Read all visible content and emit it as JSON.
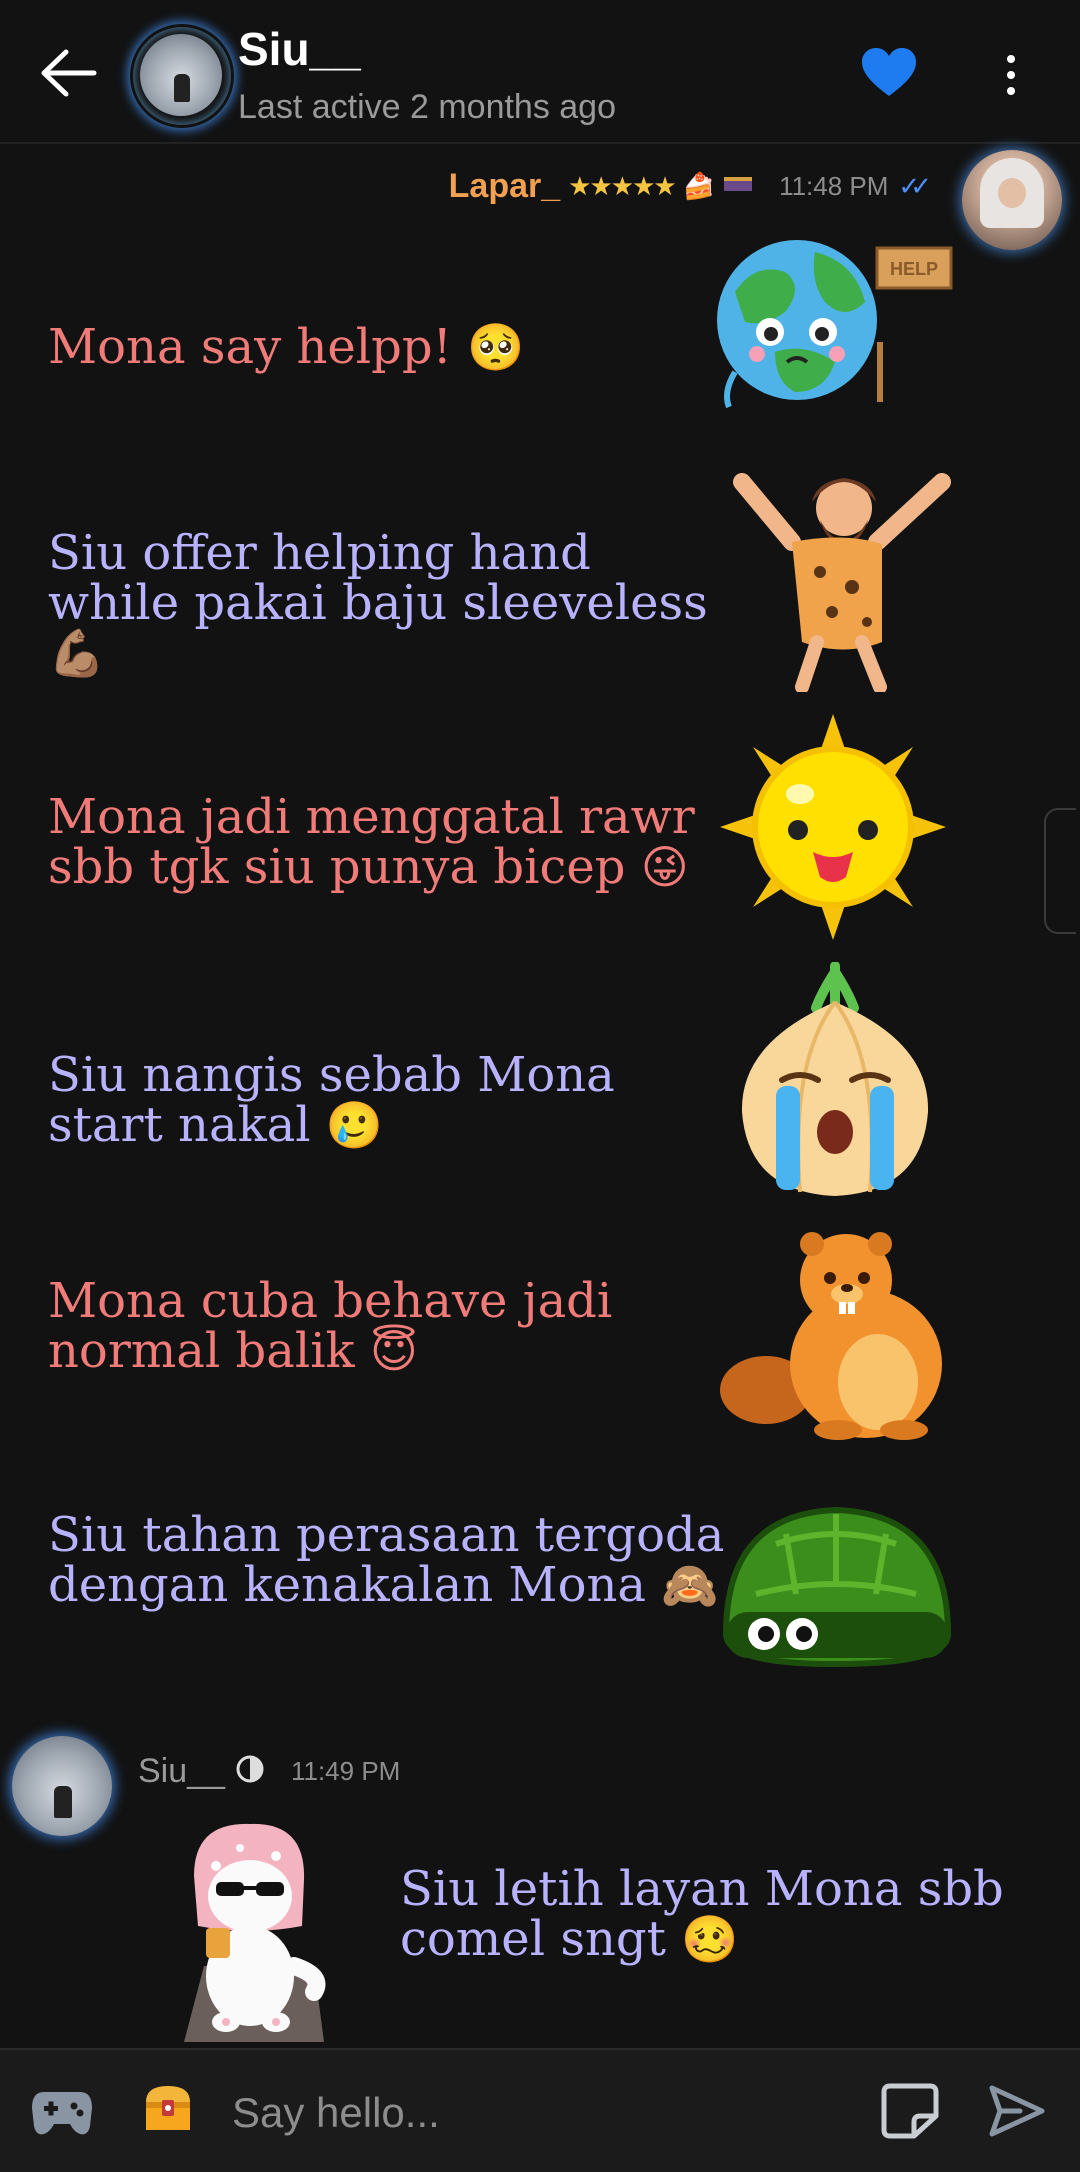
{
  "header": {
    "contact_name": "Siu__",
    "status": "Last active 2 months ago",
    "heart_color": "#1f7cf0"
  },
  "sender": {
    "name": "Lapar_",
    "stars": "★★★★★",
    "time": "11:48 PM"
  },
  "messages": [
    {
      "text": "Mona say helpp! ",
      "emoji": "🥺",
      "sticker": "earth-help-sticker"
    },
    {
      "text": "Siu offer helping hand while pakai baju sleeveless",
      "emoji": "💪🏽",
      "sticker": "caveman-sticker"
    },
    {
      "text": "Mona jadi menggatal rawr sbb tgk siu punya bicep ",
      "emoji": "😜",
      "sticker": "sun-tongue-sticker"
    },
    {
      "text": "Siu nangis sebab Mona start nakal ",
      "emoji": "🥲",
      "sticker": "crying-onion-sticker"
    },
    {
      "text": "Mona cuba behave jadi normal balik ",
      "emoji": "😇",
      "sticker": "beaver-sticker"
    },
    {
      "text": "Siu tahan perasaan tergoda dengan kenakalan Mona ",
      "emoji": "🙈",
      "sticker": "turtle-shell-sticker"
    }
  ],
  "reply": {
    "name": "Siu__",
    "time": "11:49 PM",
    "text": "Siu letih layan Mona sbb comel sngt ",
    "emoji": "🥴",
    "sticker": "cat-sunglasses-sticker"
  },
  "footer": {
    "placeholder": "Say hello..."
  }
}
